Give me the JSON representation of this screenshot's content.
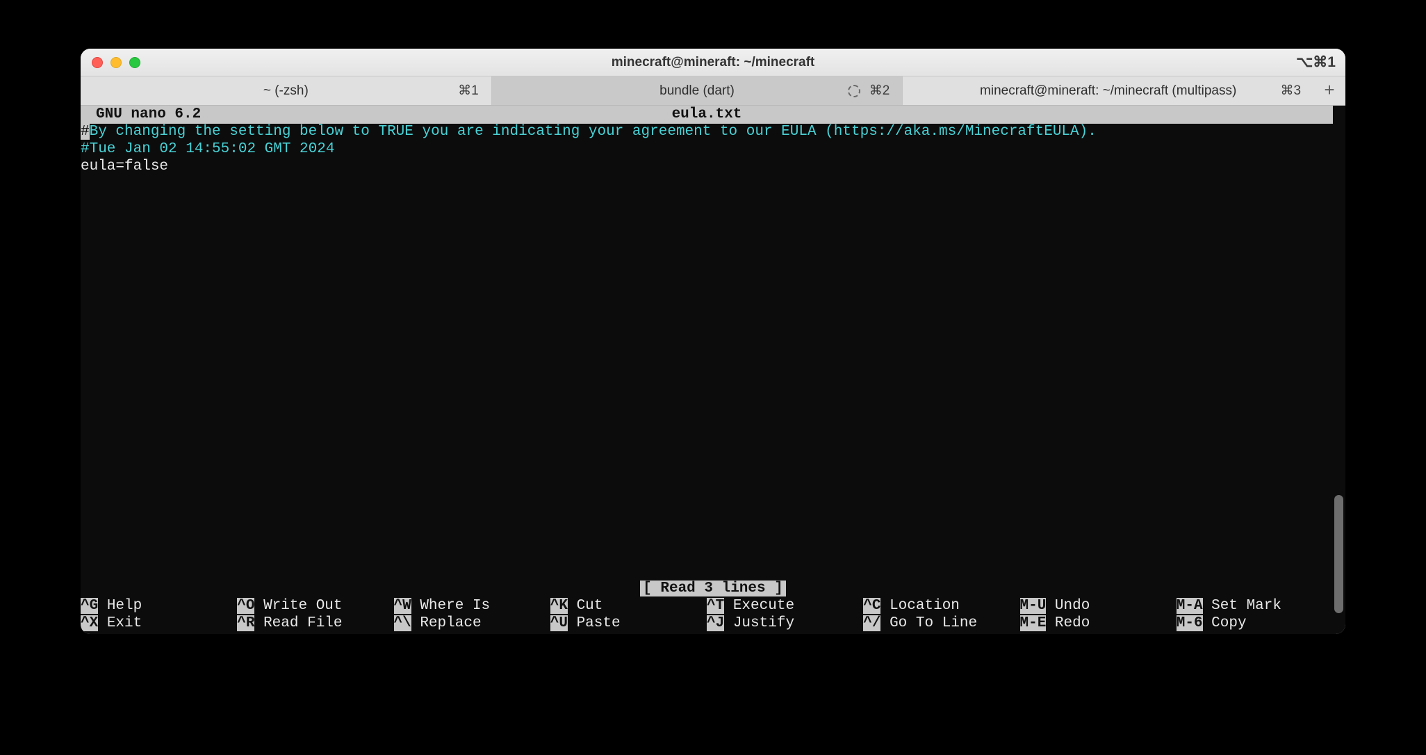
{
  "window": {
    "title": "minecraft@mineraft: ~/minecraft",
    "shortcut": "⌥⌘1"
  },
  "tabs": [
    {
      "label": "~ (-zsh)",
      "shortcut": "⌘1",
      "spinner": false,
      "active": false
    },
    {
      "label": "bundle (dart)",
      "shortcut": "⌘2",
      "spinner": true,
      "active": true
    },
    {
      "label": "minecraft@mineraft: ~/minecraft (multipass)",
      "shortcut": "⌘3",
      "spinner": false,
      "active": false
    }
  ],
  "nano": {
    "version": "GNU nano 6.2",
    "filename": "eula.txt",
    "lines": {
      "cursor_char": "#",
      "l1_rest": "By changing the setting below to TRUE you are indicating your agreement to our EULA (https://aka.ms/MinecraftEULA).",
      "l2": "#Tue Jan 02 14:55:02 GMT 2024",
      "l3": "eula=false"
    },
    "status": "[ Read 3 lines ]",
    "shortcuts_row1": [
      {
        "key": "^G",
        "label": "Help"
      },
      {
        "key": "^O",
        "label": "Write Out"
      },
      {
        "key": "^W",
        "label": "Where Is"
      },
      {
        "key": "^K",
        "label": "Cut"
      },
      {
        "key": "^T",
        "label": "Execute"
      },
      {
        "key": "^C",
        "label": "Location"
      },
      {
        "key": "M-U",
        "label": "Undo"
      },
      {
        "key": "M-A",
        "label": "Set Mark"
      }
    ],
    "shortcuts_row2": [
      {
        "key": "^X",
        "label": "Exit"
      },
      {
        "key": "^R",
        "label": "Read File"
      },
      {
        "key": "^\\",
        "label": "Replace"
      },
      {
        "key": "^U",
        "label": "Paste"
      },
      {
        "key": "^J",
        "label": "Justify"
      },
      {
        "key": "^/",
        "label": "Go To Line"
      },
      {
        "key": "M-E",
        "label": "Redo"
      },
      {
        "key": "M-6",
        "label": "Copy"
      }
    ]
  }
}
